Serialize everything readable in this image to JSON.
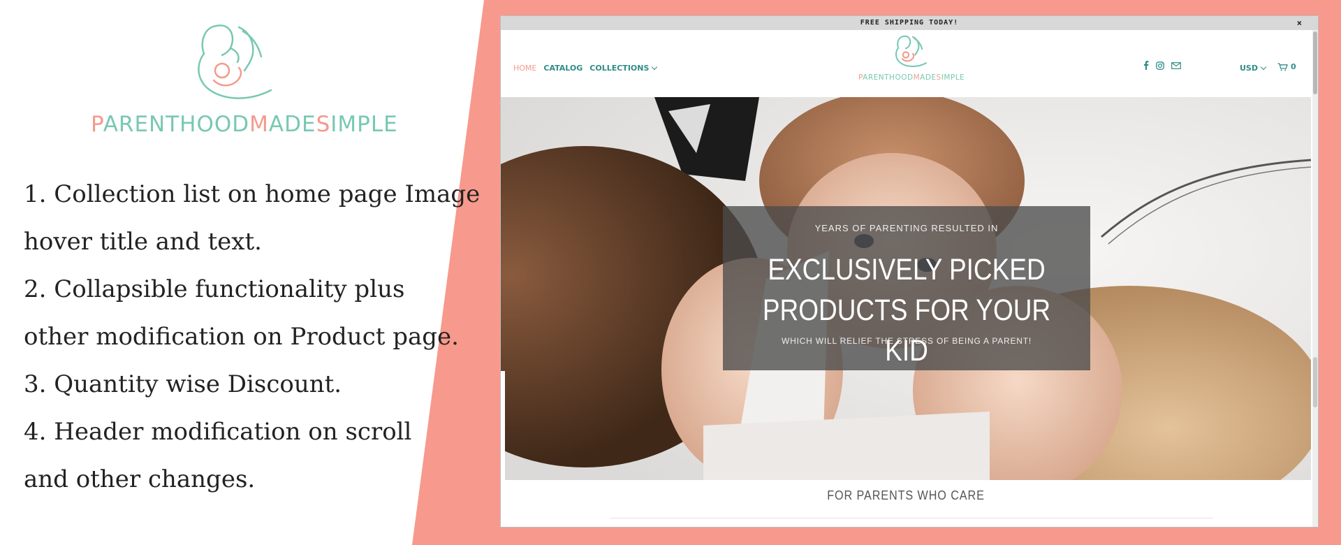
{
  "brand": {
    "part1": "PARENTHOOD",
    "part2": "M",
    "part3": "ADE",
    "part4": "S",
    "part5": "IMPLE",
    "teal": "#78c8b2",
    "salmon": "#f39a8d"
  },
  "features": [
    "1. Collection list on home page Image",
    "hover title and text.",
    "2. Collapsible functionality plus",
    "other modification on Product page.",
    "3. Quantity wise Discount.",
    "4. Header modification on scroll",
    "and other changes."
  ],
  "site": {
    "announcement": "FREE SHIPPING TODAY!",
    "announcement_close": "×",
    "nav": {
      "home": "HOME",
      "catalog": "CATALOG",
      "collections": "COLLECTIONS"
    },
    "social_icons": [
      "facebook-icon",
      "instagram-icon",
      "mail-icon"
    ],
    "currency": "USD",
    "cart_count": "0",
    "hero": {
      "kicker": "YEARS OF PARENTING RESULTED IN",
      "headline_line1": "EXCLUSIVELY PICKED",
      "headline_line2": "PRODUCTS FOR YOUR KID",
      "subtext": "WHICH WILL RELIEF THE STRESS OF BEING A PARENT!"
    },
    "section_title": "FOR PARENTS WHO CARE"
  },
  "colors": {
    "background_band": "#f7998c",
    "nav_teal": "#2f8c87",
    "nav_active": "#f39a8d"
  }
}
